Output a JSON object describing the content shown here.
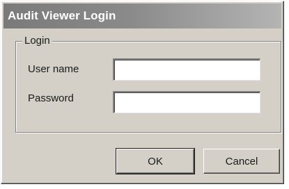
{
  "window": {
    "title": "Audit Viewer Login"
  },
  "login_group": {
    "legend": "Login",
    "username_label": "User name",
    "username_value": "",
    "password_label": "Password",
    "password_value": ""
  },
  "buttons": {
    "ok_label": "OK",
    "cancel_label": "Cancel"
  },
  "colors": {
    "dialog_face": "#d4d0c8",
    "titlebar_start": "#7a7a7a",
    "titlebar_end": "#b4b4b4",
    "title_text": "#ffffff"
  }
}
